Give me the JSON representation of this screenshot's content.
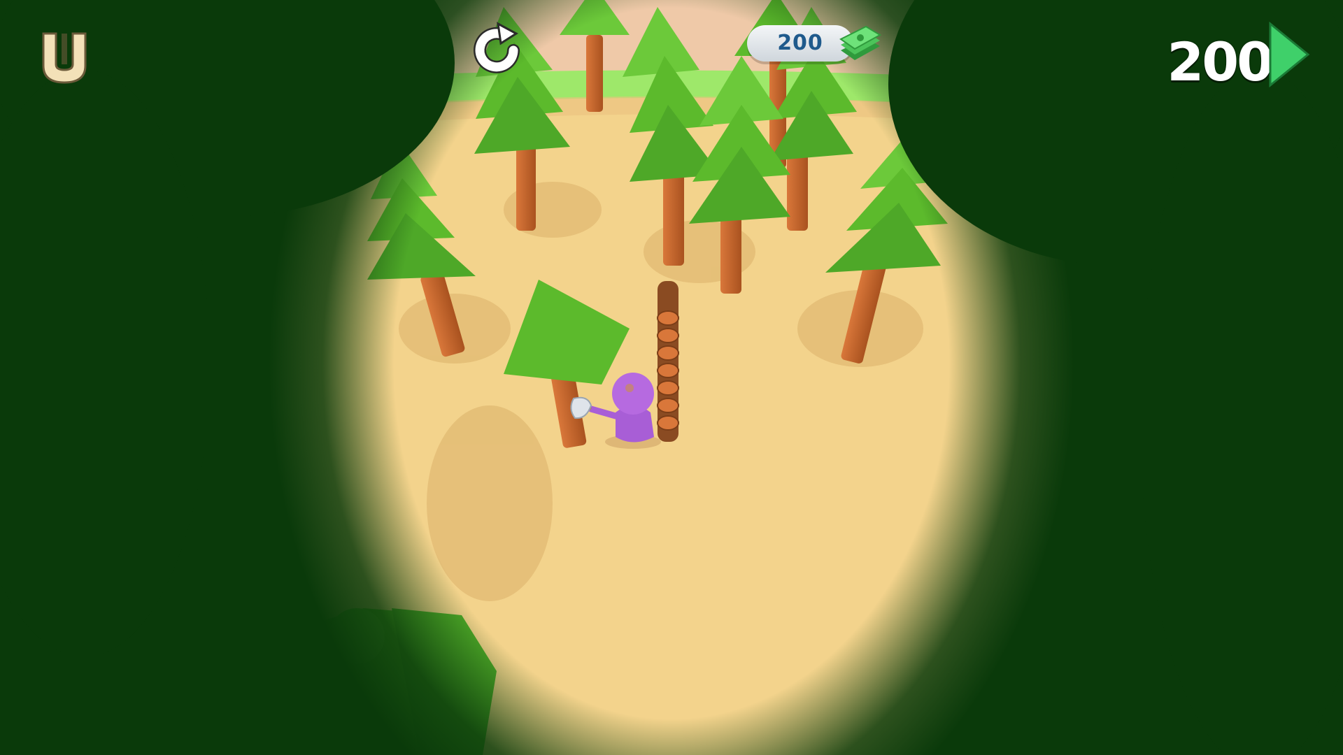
{
  "hud": {
    "cash": "200",
    "wood_count": "200",
    "logo_icon": "magnet-u-icon",
    "restart_icon": "restart-icon",
    "cash_icon": "cash-stack-icon",
    "next_icon": "play-arrow-icon"
  },
  "colors": {
    "sand": "#f3d38c",
    "grass": "#9ee86a",
    "foliage": "#5cba2c",
    "trunk": "#c9682c",
    "vignette": "#0a3a0a",
    "player": "#b66ae0",
    "cash_text": "#1f5a8c",
    "arrow": "#3fd06a"
  }
}
